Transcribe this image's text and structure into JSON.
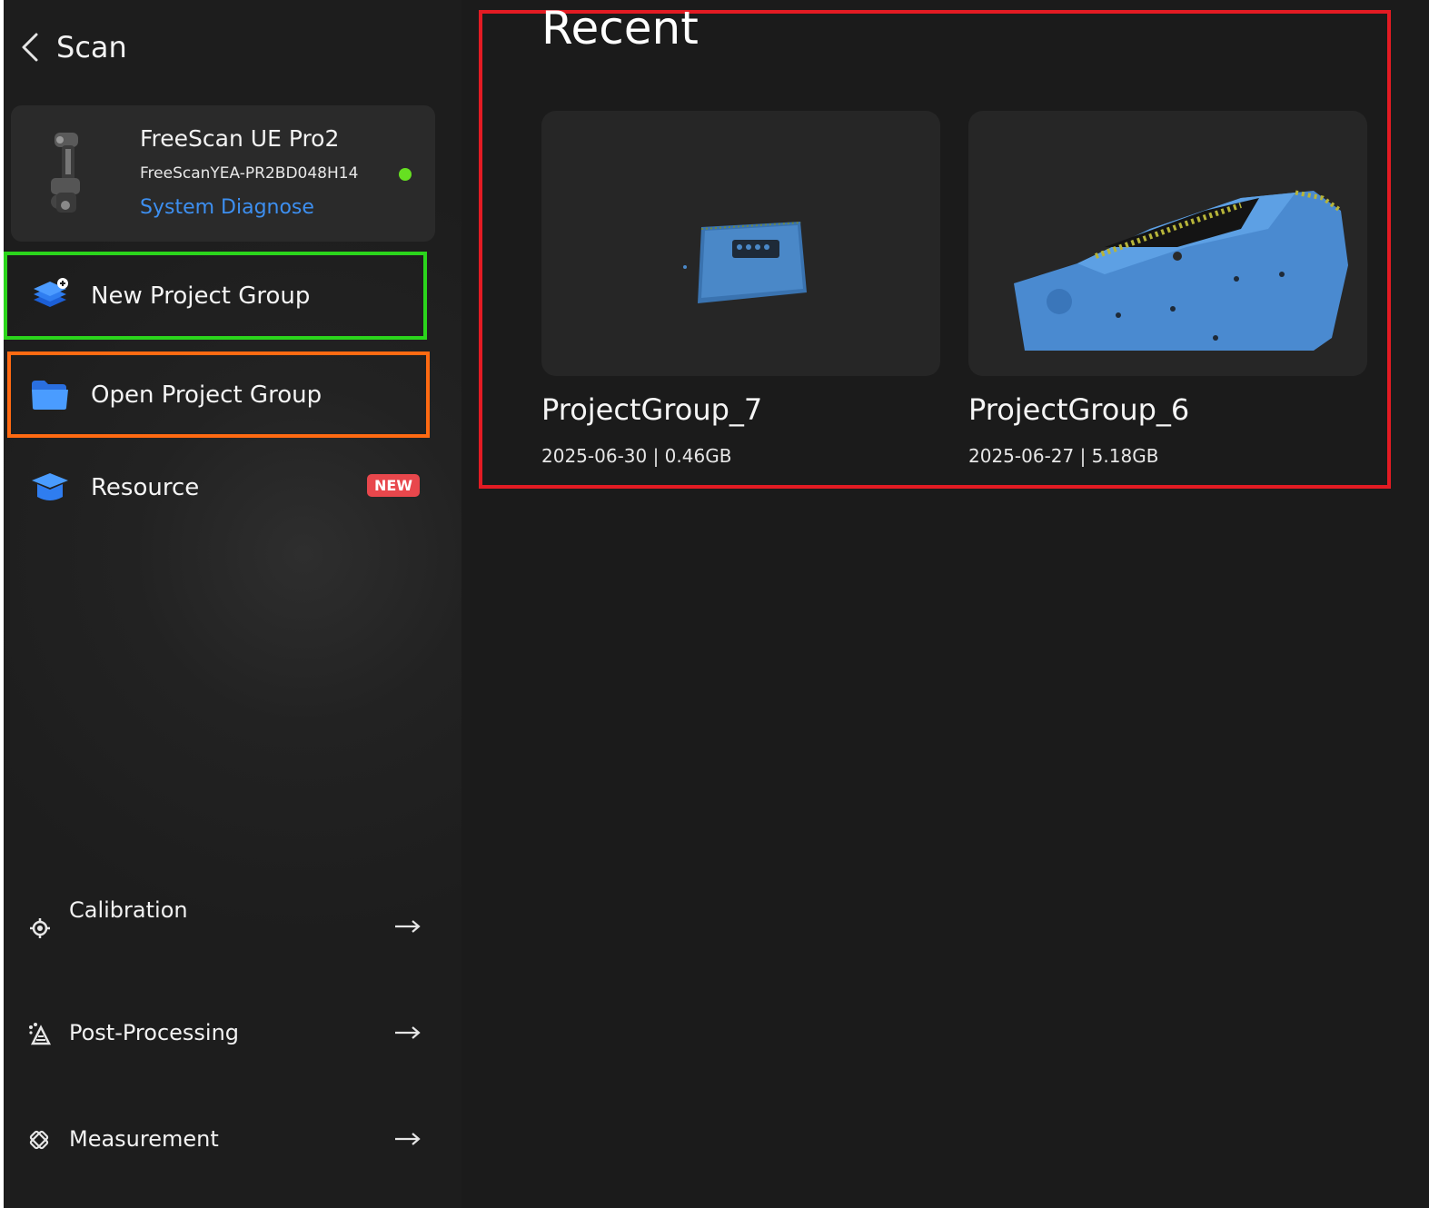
{
  "header": {
    "title": "Scan"
  },
  "device": {
    "name": "FreeScan UE Pro2",
    "serial": "FreeScanYEA-PR2BD048H14",
    "status_color": "#66e021",
    "diagnose_label": "System Diagnose"
  },
  "menu": {
    "new_project": "New Project Group",
    "open_project": "Open Project Group",
    "resource": "Resource",
    "resource_badge": "NEW"
  },
  "tools": {
    "calibration": "Calibration",
    "post_processing": "Post-Processing",
    "measurement": "Measurement"
  },
  "recent": {
    "title": "Recent",
    "items": [
      {
        "name": "ProjectGroup_7",
        "meta": "2025-06-30 | 0.46GB"
      },
      {
        "name": "ProjectGroup_6",
        "meta": "2025-06-27 | 5.18GB"
      }
    ]
  },
  "colors": {
    "accent_link": "#3d8ff0",
    "highlight_green": "#2bd51c",
    "highlight_orange": "#ff6a12",
    "highlight_red": "#e31b23",
    "badge": "#e8474c"
  }
}
